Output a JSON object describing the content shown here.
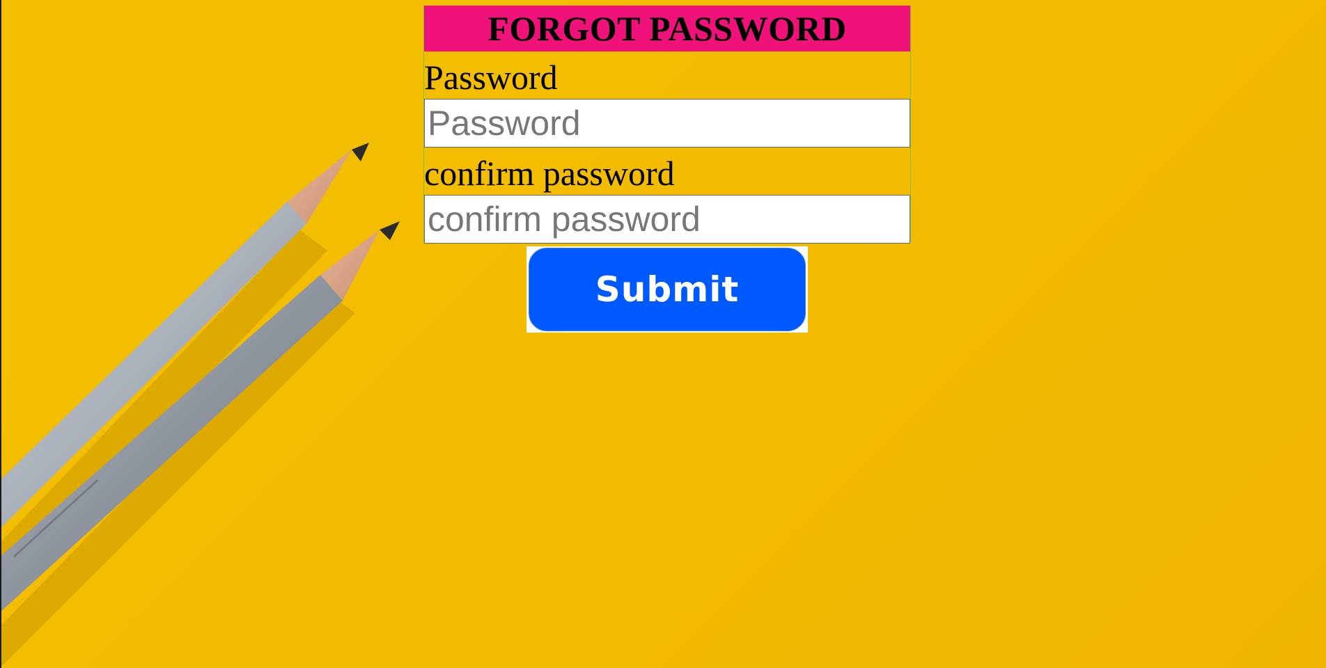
{
  "background": {
    "color": "#f4bd00",
    "image": "two-gray-pencils-on-yellow"
  },
  "form": {
    "title": "FORGOT PASSWORD",
    "title_bg": "#f0127a",
    "password_label": "Password",
    "password_placeholder": "Password",
    "confirm_label": "confirm password",
    "confirm_placeholder": "confirm password",
    "submit_label": "Submit",
    "submit_color": "#0059ff"
  }
}
